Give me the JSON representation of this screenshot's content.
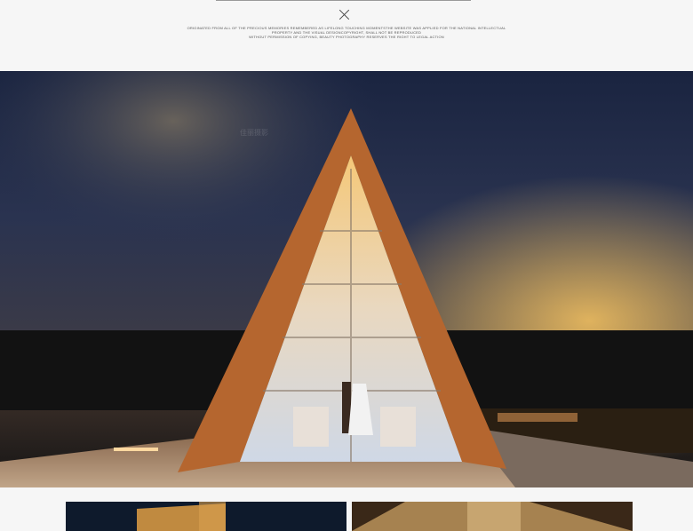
{
  "copyright": {
    "line1": "ORIGINATED FROM ALL OF THE PRECIOUS MEMORIES REMEMBERED AS LIFELONG TOUCHING MOMENTSTHE WEBSITE WAS APPLIED FOR THE NATIONAL INTELLECTUAL",
    "line2": "PROPERTY AND THE VISUAL DESIGNCOPYRIGHT, SHALL NOT BE REPRODUCED",
    "line3": "WITHOUT PERMISSION OF COPYING, BEAUTY PHOTOGRAPHY RESERVES THE RIGHT TO LEGAL ACTION"
  },
  "watermark": "佳丽摄影",
  "colors": {
    "page_bg": "#f6f6f6",
    "sky_top": "#1c2740",
    "sunset": "#e7a542",
    "frame": "#b5662f"
  },
  "icons": {
    "close": "close-icon"
  }
}
